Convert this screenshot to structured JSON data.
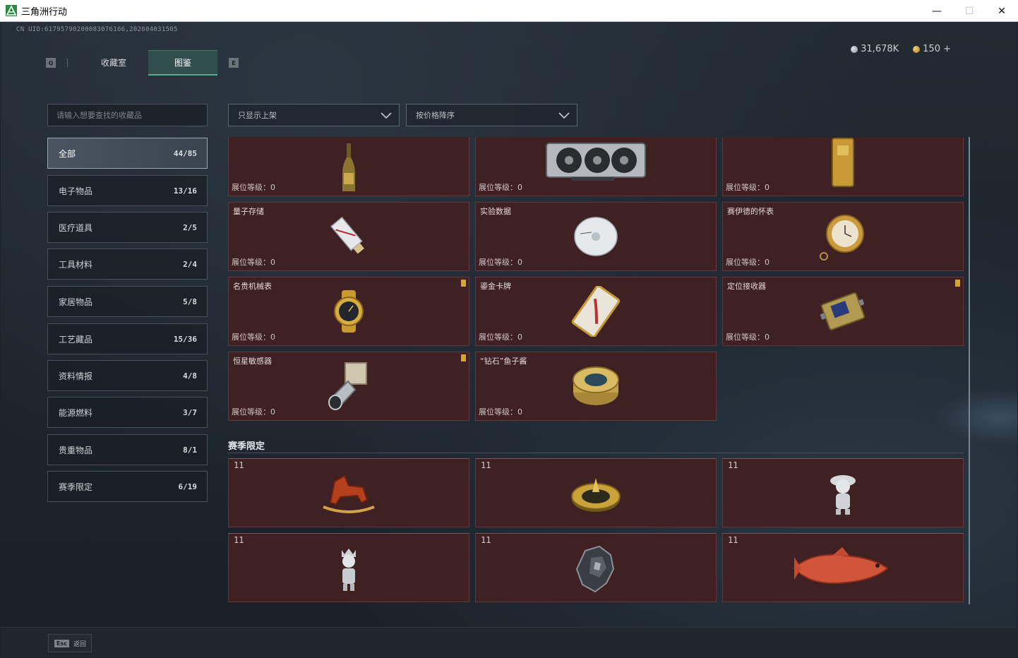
{
  "window": {
    "title": "三角洲行动",
    "minimize": "—",
    "maximize": "☐",
    "close": "✕"
  },
  "header": {
    "uid": "CN UID:6179579020008307616​6,202604031505",
    "tab_key_left": "Q",
    "tab_key_right": "E",
    "tabs": [
      {
        "label": "收藏室",
        "active": false
      },
      {
        "label": "图鉴",
        "active": true
      }
    ],
    "currency": [
      {
        "icon": "silver-coin-icon",
        "value": "31,678K"
      },
      {
        "icon": "gold-coin-icon",
        "value": "150 +"
      }
    ]
  },
  "search": {
    "placeholder": "请输入想要查找的收藏品"
  },
  "filters": {
    "display": "只显示上架",
    "sort": "按价格降序"
  },
  "categories": [
    {
      "label": "全部",
      "count": "44/85",
      "active": true
    },
    {
      "label": "电子物品",
      "count": "13/16",
      "active": false
    },
    {
      "label": "医疗道具",
      "count": "2/5",
      "active": false
    },
    {
      "label": "工具材料",
      "count": "2/4",
      "active": false
    },
    {
      "label": "家居物品",
      "count": "5/8",
      "active": false
    },
    {
      "label": "工艺藏品",
      "count": "15/36",
      "active": false
    },
    {
      "label": "资料情报",
      "count": "4/8",
      "active": false
    },
    {
      "label": "能源燃料",
      "count": "3/7",
      "active": false
    },
    {
      "label": "贵重物品",
      "count": "8/1",
      "active": false
    },
    {
      "label": "赛季限定",
      "count": "6/19",
      "active": false
    }
  ],
  "items": [
    {
      "name": "",
      "level": "展位等级：0",
      "icon": "champagne-bottle-icon",
      "badge": false
    },
    {
      "name": "",
      "level": "展位等级：0",
      "icon": "graphics-card-icon",
      "badge": false
    },
    {
      "name": "",
      "level": "展位等级：0",
      "icon": "gold-bar-icon",
      "badge": false
    },
    {
      "name": "量子存储",
      "level": "展位等级：0",
      "icon": "usb-drive-icon",
      "badge": false
    },
    {
      "name": "实验数据",
      "level": "展位等级：0",
      "icon": "data-disc-icon",
      "badge": false
    },
    {
      "name": "赛伊德的怀表",
      "level": "展位等级：0",
      "icon": "pocket-watch-icon",
      "badge": false
    },
    {
      "name": "名贵机械表",
      "level": "展位等级：0",
      "icon": "wristwatch-icon",
      "badge": true
    },
    {
      "name": "鎏金卡牌",
      "level": "展位等级：0",
      "icon": "gilded-card-icon",
      "badge": false
    },
    {
      "name": "定位接收器",
      "level": "展位等级：0",
      "icon": "receiver-icon",
      "badge": true
    },
    {
      "name": "恒星敏感器",
      "level": "展位等级：0",
      "icon": "star-sensor-icon",
      "badge": true
    },
    {
      "name": "“钻石”鱼子酱",
      "level": "展位等级：0",
      "icon": "caviar-tin-icon",
      "badge": false
    }
  ],
  "seasonal": {
    "title": "赛季限定",
    "items": [
      {
        "num": "11",
        "icon": "rocking-horse-icon"
      },
      {
        "num": "11",
        "icon": "golden-compass-icon"
      },
      {
        "num": "11",
        "icon": "figurine-icon"
      },
      {
        "num": "11",
        "icon": "doll-figurine-icon"
      },
      {
        "num": "11",
        "icon": "crystal-mech-icon"
      },
      {
        "num": "11",
        "icon": "red-fish-icon"
      }
    ]
  },
  "footer": {
    "esc_key": "Esc",
    "esc_label": "返回"
  }
}
